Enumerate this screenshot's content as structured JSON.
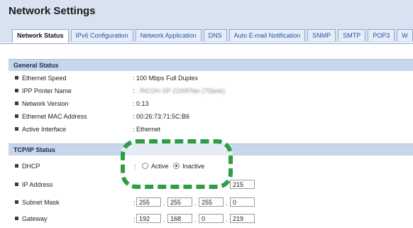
{
  "page": {
    "title": "Network Settings"
  },
  "tabs": [
    "Network Status",
    "IPv6 Configuration",
    "Network Application",
    "DNS",
    "Auto E-mail Notification",
    "SNMP",
    "SMTP",
    "POP3",
    "W"
  ],
  "general": {
    "header": "General Status",
    "rows": [
      {
        "label": "Ethernet Speed",
        "value": ": 100 Mbps Full Duplex"
      },
      {
        "label": "IPP Printer Name",
        "value": ": RICOH SP 2100FNw (7f3a4e)"
      },
      {
        "label": "Network Version",
        "value": ": 0.13"
      },
      {
        "label": "Ethernet MAC Address",
        "value": ": 00:26:73:71:5C:B6"
      },
      {
        "label": "Active Interface",
        "value": ": Ethernet"
      }
    ]
  },
  "tcpip": {
    "header": "TCP/IP Status",
    "dhcp": {
      "label": "DHCP",
      "colon": ":",
      "active_label": "Active",
      "inactive_label": "Inactive",
      "selected": "Inactive"
    },
    "ip_address": {
      "label": "IP Address",
      "octets": [
        "",
        "",
        "",
        "215"
      ]
    },
    "subnet_mask": {
      "label": "Subnet Mask",
      "octets": [
        "255",
        "255",
        "255",
        "0"
      ]
    },
    "gateway": {
      "label": "Gateway",
      "octets": [
        "192",
        "168",
        "0",
        "219"
      ]
    },
    "colon": ":",
    "sep": "."
  },
  "colors": {
    "header_bg": "#d9e2f1",
    "section_bg": "#c8d6ec",
    "tab_text": "#2454a6",
    "highlight": "#2e9e44"
  }
}
